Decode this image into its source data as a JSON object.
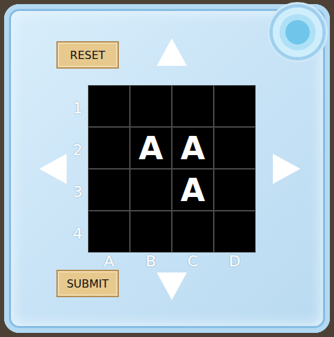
{
  "buttons": {
    "reset": "RESET",
    "submit": "SUBMIT"
  },
  "grid": {
    "row_labels": [
      "1",
      "2",
      "3",
      "4"
    ],
    "column_labels": [
      "A",
      "B",
      "C",
      "D"
    ],
    "rows": [
      [
        "",
        "",
        "",
        ""
      ],
      [
        "",
        "A",
        "A",
        ""
      ],
      [
        "",
        "",
        "A",
        ""
      ],
      [
        "",
        "",
        "",
        ""
      ]
    ]
  }
}
